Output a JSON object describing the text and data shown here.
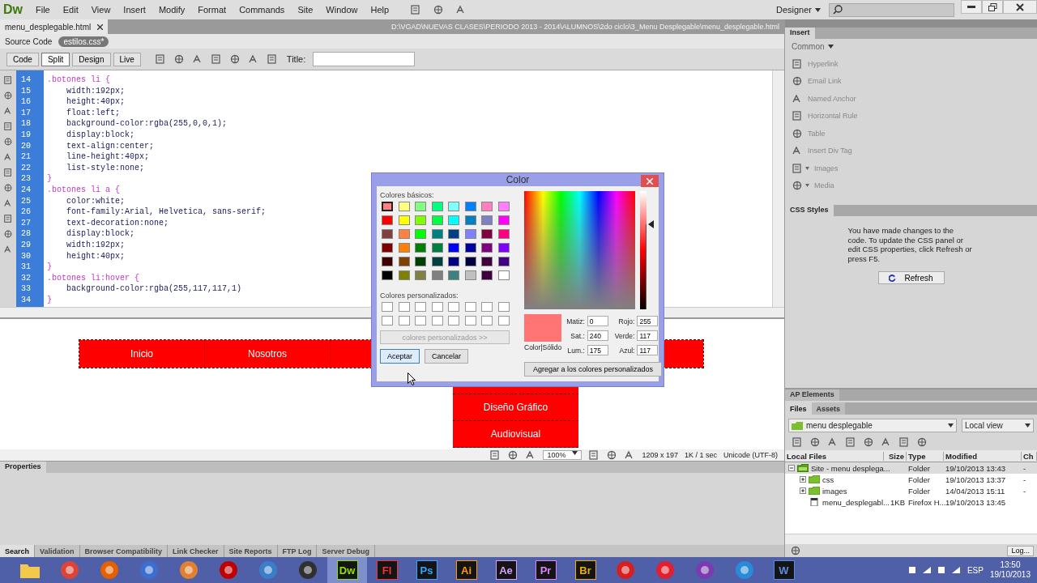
{
  "app": {
    "logo": "Dw",
    "menu": [
      "File",
      "Edit",
      "View",
      "Insert",
      "Modify",
      "Format",
      "Commands",
      "Site",
      "Window",
      "Help"
    ],
    "workspace": "Designer"
  },
  "document": {
    "tab": "menu_desplegable.html",
    "path": "D:\\VGAD\\NUEVAS CLASES\\PERIODO 2013 - 2014\\ALUMNOS\\2do ciclo\\3_Menu Desplegable\\menu_desplegable.html",
    "source_label": "Source Code",
    "related_file": "estilos.css*"
  },
  "view_tabs": [
    {
      "label": "Code",
      "selected": false
    },
    {
      "label": "Split",
      "selected": true
    },
    {
      "label": "Design",
      "selected": false
    },
    {
      "label": "Live",
      "selected": false
    }
  ],
  "title_label": "Title:",
  "code_lines": [
    {
      "number": "14",
      "kind": "selector",
      "text": ".botones li {"
    },
    {
      "number": "15",
      "kind": "property",
      "text": "width:192px;"
    },
    {
      "number": "16",
      "kind": "property",
      "text": "height:40px;"
    },
    {
      "number": "17",
      "kind": "property",
      "text": "float:left;"
    },
    {
      "number": "18",
      "kind": "property",
      "text": "background-color:rgba(255,0,0,1);"
    },
    {
      "number": "19",
      "kind": "property",
      "text": "display:block;"
    },
    {
      "number": "20",
      "kind": "property",
      "text": "text-align:center;"
    },
    {
      "number": "21",
      "kind": "property",
      "text": "line-height:40px;"
    },
    {
      "number": "22",
      "kind": "property",
      "text": "list-style:none;"
    },
    {
      "number": "23",
      "kind": "brace",
      "text": "}"
    },
    {
      "number": "24",
      "kind": "selector",
      "text": ".botones li a {"
    },
    {
      "number": "25",
      "kind": "property",
      "text": "color:white;"
    },
    {
      "number": "26",
      "kind": "property",
      "text": "font-family:Arial, Helvetica, sans-serif;"
    },
    {
      "number": "27",
      "kind": "property",
      "text": "text-decoration:none;"
    },
    {
      "number": "28",
      "kind": "property",
      "text": "display:block;"
    },
    {
      "number": "29",
      "kind": "property",
      "text": "width:192px;"
    },
    {
      "number": "30",
      "kind": "property",
      "text": "height:40px;"
    },
    {
      "number": "31",
      "kind": "brace",
      "text": "}"
    },
    {
      "number": "32",
      "kind": "selector",
      "text": ".botones li:hover {"
    },
    {
      "number": "33",
      "kind": "property",
      "text": "background-color:rgba(255,117,117,1)"
    },
    {
      "number": "34",
      "kind": "brace",
      "text": "}"
    }
  ],
  "design_menu": {
    "items": [
      "Inicio",
      "Nosotros"
    ],
    "dropdown": [
      "Diseño Gráfico",
      "Audiovisual"
    ]
  },
  "status_bar": {
    "zoom": "100%",
    "size": "1209 x 197",
    "download": "1K / 1 sec",
    "encoding": "Unicode (UTF-8)"
  },
  "properties": {
    "title": "Properties"
  },
  "results_tabs": [
    {
      "label": "Search",
      "selected": true
    },
    {
      "label": "Validation",
      "selected": false
    },
    {
      "label": "Browser Compatibility",
      "selected": false
    },
    {
      "label": "Link Checker",
      "selected": false
    },
    {
      "label": "Site Reports",
      "selected": false
    },
    {
      "label": "FTP Log",
      "selected": false
    },
    {
      "label": "Server Debug",
      "selected": false
    }
  ],
  "insert_panel": {
    "title": "Insert",
    "category": "Common",
    "items": [
      {
        "label": "Hyperlink",
        "has_menu": false
      },
      {
        "label": "Email Link",
        "has_menu": false
      },
      {
        "label": "Named Anchor",
        "has_menu": false
      },
      {
        "label": "Horizontal Rule",
        "has_menu": false
      },
      {
        "label": "Table",
        "has_menu": false
      },
      {
        "label": "Insert Div Tag",
        "has_menu": false
      },
      {
        "label": "Images",
        "has_menu": true
      },
      {
        "label": "Media",
        "has_menu": true
      }
    ]
  },
  "css_panel": {
    "title": "CSS Styles",
    "message": "You have made changes to the code. To update the CSS panel or edit CSS properties, click Refresh or press F5.",
    "button": "Refresh"
  },
  "ap_panel": {
    "title": "AP Elements"
  },
  "files_panel": {
    "tabs": [
      {
        "label": "Files",
        "selected": true
      },
      {
        "label": "Assets",
        "selected": false
      }
    ],
    "site": "menu desplegable",
    "view": "Local view",
    "columns": [
      "Local Files",
      "Size",
      "Type",
      "Modified",
      "Ch"
    ],
    "rows": [
      {
        "name": "Site - menu desplega...",
        "kind": "site",
        "type": "Folder",
        "modified": "19/10/2013 13:43",
        "column_5": "-",
        "expanded": true,
        "selected": true,
        "children": [
          {
            "name": "css",
            "kind": "folder",
            "type": "Folder",
            "modified": "19/10/2013 13:37",
            "column_5": "-",
            "expanded": false,
            "selected": false
          },
          {
            "name": "images",
            "kind": "folder",
            "type": "Folder",
            "modified": "14/04/2013 15:11",
            "column_5": "-",
            "expanded": false,
            "selected": false
          },
          {
            "name": "menu_desplegabl...",
            "kind": "file",
            "size": "1KB",
            "type": "Firefox H...",
            "modified": "19/10/2013 13:45",
            "selected": false
          }
        ]
      }
    ],
    "log_button": "Log..."
  },
  "color_dialog": {
    "title": "Color",
    "basic_label": "Colores básicos:",
    "basic_colors": [
      {
        "color": "#ff8080",
        "selected": true
      },
      {
        "color": "#ffff80",
        "selected": false
      },
      {
        "color": "#80ff80",
        "selected": false
      },
      {
        "color": "#00ff80",
        "selected": false
      },
      {
        "color": "#80ffff",
        "selected": false
      },
      {
        "color": "#0080ff",
        "selected": false
      },
      {
        "color": "#ff80c0",
        "selected": false
      },
      {
        "color": "#ff80ff",
        "selected": false
      },
      {
        "color": "#ff0000",
        "selected": false
      },
      {
        "color": "#ffff00",
        "selected": false
      },
      {
        "color": "#80ff00",
        "selected": false
      },
      {
        "color": "#00ff40",
        "selected": false
      },
      {
        "color": "#00ffff",
        "selected": false
      },
      {
        "color": "#0080c0",
        "selected": false
      },
      {
        "color": "#8080c0",
        "selected": false
      },
      {
        "color": "#ff00ff",
        "selected": false
      },
      {
        "color": "#804040",
        "selected": false
      },
      {
        "color": "#ff8040",
        "selected": false
      },
      {
        "color": "#00ff00",
        "selected": false
      },
      {
        "color": "#008080",
        "selected": false
      },
      {
        "color": "#004080",
        "selected": false
      },
      {
        "color": "#8080ff",
        "selected": false
      },
      {
        "color": "#800040",
        "selected": false
      },
      {
        "color": "#ff0080",
        "selected": false
      },
      {
        "color": "#800000",
        "selected": false
      },
      {
        "color": "#ff8000",
        "selected": false
      },
      {
        "color": "#008000",
        "selected": false
      },
      {
        "color": "#008040",
        "selected": false
      },
      {
        "color": "#0000ff",
        "selected": false
      },
      {
        "color": "#0000a0",
        "selected": false
      },
      {
        "color": "#800080",
        "selected": false
      },
      {
        "color": "#8000ff",
        "selected": false
      },
      {
        "color": "#400000",
        "selected": false
      },
      {
        "color": "#804000",
        "selected": false
      },
      {
        "color": "#004000",
        "selected": false
      },
      {
        "color": "#004040",
        "selected": false
      },
      {
        "color": "#000080",
        "selected": false
      },
      {
        "color": "#000040",
        "selected": false
      },
      {
        "color": "#400040",
        "selected": false
      },
      {
        "color": "#400080",
        "selected": false
      },
      {
        "color": "#000000",
        "selected": false
      },
      {
        "color": "#808000",
        "selected": false
      },
      {
        "color": "#808040",
        "selected": false
      },
      {
        "color": "#808080",
        "selected": false
      },
      {
        "color": "#408080",
        "selected": false
      },
      {
        "color": "#c0c0c0",
        "selected": false
      },
      {
        "color": "#400040",
        "selected": false
      },
      {
        "color": "#ffffff",
        "selected": false
      }
    ],
    "custom_label": "Colores personalizados:",
    "custom_colors": [
      {
        "color": "#ffffff"
      },
      {
        "color": "#ffffff"
      },
      {
        "color": "#ffffff"
      },
      {
        "color": "#ffffff"
      },
      {
        "color": "#ffffff"
      },
      {
        "color": "#ffffff"
      },
      {
        "color": "#ffffff"
      },
      {
        "color": "#ffffff"
      },
      {
        "color": "#ffffff"
      },
      {
        "color": "#ffffff"
      },
      {
        "color": "#ffffff"
      },
      {
        "color": "#ffffff"
      },
      {
        "color": "#ffffff"
      },
      {
        "color": "#ffffff"
      },
      {
        "color": "#ffffff"
      },
      {
        "color": "#ffffff"
      }
    ],
    "define_button": {
      "label": "colores personalizados >>",
      "disabled": true
    },
    "luminance": {
      "level": 0.72
    },
    "preview": {
      "color": "#ff7575",
      "label": "Color|Sólido"
    },
    "fields": [
      {
        "label": "Matiz:",
        "value": "0"
      },
      {
        "label": "Sat.:",
        "value": "240"
      },
      {
        "label": "Lum.:",
        "value": "175"
      },
      {
        "label": "Rojo:",
        "value": "255"
      },
      {
        "label": "Verde:",
        "value": "117"
      },
      {
        "label": "Azul:",
        "value": "117"
      }
    ],
    "ok_button": "Aceptar",
    "cancel_button": "Cancelar",
    "add_button": "Agregar a los colores personalizados"
  },
  "taskbar": {
    "apps": [
      {
        "kind": "folder",
        "color": "#f2c94c",
        "selected": false
      },
      {
        "kind": "round",
        "color": "#db4437",
        "selected": false
      },
      {
        "kind": "round",
        "color": "#e66000",
        "selected": false
      },
      {
        "kind": "round",
        "color": "#3a6fd0",
        "selected": false
      },
      {
        "kind": "round",
        "color": "#e08030",
        "selected": false
      },
      {
        "kind": "round",
        "color": "#bf0000",
        "selected": false
      },
      {
        "kind": "round",
        "color": "#3a7ec8",
        "selected": false
      },
      {
        "kind": "round",
        "color": "#303030",
        "selected": false
      },
      {
        "kind": "badge",
        "label": "Dw",
        "color": "#8fe000",
        "selected": true
      },
      {
        "kind": "badge",
        "label": "Fl",
        "color": "#ff3030",
        "selected": false
      },
      {
        "kind": "badge",
        "label": "Ps",
        "color": "#30a8ff",
        "selected": false
      },
      {
        "kind": "badge",
        "label": "Ai",
        "color": "#ff9a00",
        "selected": false
      },
      {
        "kind": "badge",
        "label": "Ae",
        "color": "#d8a0ff",
        "selected": false
      },
      {
        "kind": "badge",
        "label": "Pr",
        "color": "#e080ff",
        "selected": false
      },
      {
        "kind": "badge",
        "label": "Br",
        "color": "#e8b000",
        "selected": false
      },
      {
        "kind": "round",
        "color": "#d42020",
        "selected": false
      },
      {
        "kind": "round",
        "color": "#e02030",
        "selected": false
      },
      {
        "kind": "round",
        "color": "#7a3ab0",
        "selected": false
      },
      {
        "kind": "round",
        "color": "#2a8ad8",
        "selected": false
      },
      {
        "kind": "badge",
        "label": "W",
        "color": "#5a8ae0",
        "selected": false
      }
    ],
    "language": "ESP",
    "time": "13:50",
    "date": "19/10/2013"
  }
}
